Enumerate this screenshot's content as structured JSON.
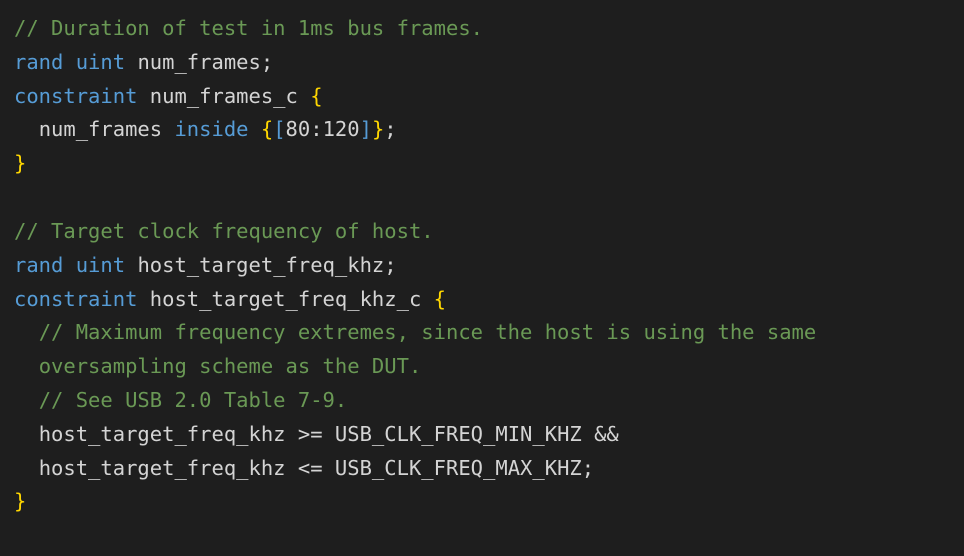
{
  "lines": {
    "c1": "// Duration of test in 1ms bus frames.",
    "kw_rand1": "rand",
    "ty_uint1": "uint",
    "id_num_frames": "num_frames",
    "kw_constraint1": "constraint",
    "id_num_frames_c": "num_frames_c",
    "id_num_frames2": "num_frames",
    "kw_inside": "inside",
    "num_80": "80",
    "num_120": "120",
    "c2": "// Target clock frequency of host.",
    "kw_rand2": "rand",
    "ty_uint2": "uint",
    "id_host_freq": "host_target_freq_khz",
    "kw_constraint2": "constraint",
    "id_host_freq_c": "host_target_freq_khz_c",
    "c3a": "// Maximum frequency extremes, since the host is using the same",
    "c3b": "oversampling scheme as the DUT.",
    "c4": "// See USB 2.0 Table 7-9.",
    "id_host_freq2": "host_target_freq_khz",
    "op_ge": ">=",
    "id_min": "USB_CLK_FREQ_MIN_KHZ",
    "op_and": "&&",
    "id_host_freq3": "host_target_freq_khz",
    "op_le": "<=",
    "id_max": "USB_CLK_FREQ_MAX_KHZ"
  }
}
